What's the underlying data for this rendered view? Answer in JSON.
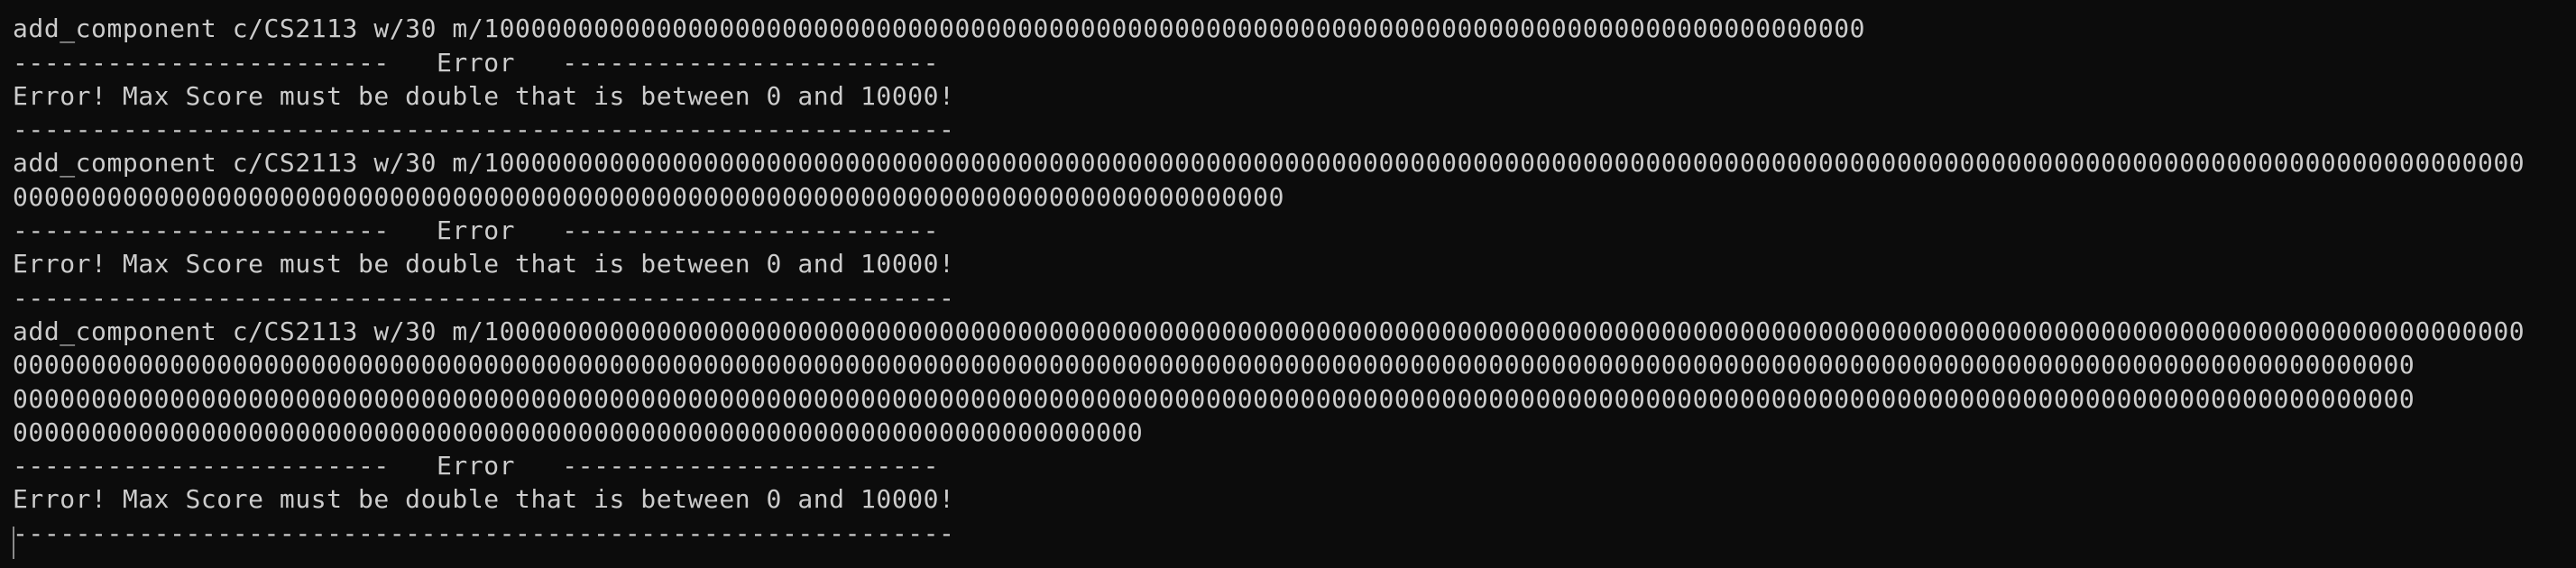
{
  "terminal": {
    "lines": [
      "------------------------------------------------------------",
      "add_component c/CS2113 w/30 m/1000000000000000000000000000000000000000000000000000000000000000000000000000000000000000",
      "------------------------   Error   ------------------------",
      "Error! Max Score must be double that is between 0 and 10000!",
      "------------------------------------------------------------",
      "add_component c/CS2113 w/30 m/1000000000000000000000000000000000000000000000000000000000000000000000000000000000000000000000000000000000000000000000000000000000",
      "000000000000000000000000000000000000000000000000000000000000000000000000000000000",
      "------------------------   Error   ------------------------",
      "Error! Max Score must be double that is between 0 and 10000!",
      "------------------------------------------------------------",
      "add_component c/CS2113 w/30 m/1000000000000000000000000000000000000000000000000000000000000000000000000000000000000000000000000000000000000000000000000000000000",
      "000000000000000000000000000000000000000000000000000000000000000000000000000000000000000000000000000000000000000000000000000000000000000000000000000000000",
      "000000000000000000000000000000000000000000000000000000000000000000000000000000000000000000000000000000000000000000000000000000000000000000000000000000000",
      "000000000000000000000000000000000000000000000000000000000000000000000000",
      "------------------------   Error   ------------------------",
      "Error! Max Score must be double that is between 0 and 10000!",
      "------------------------------------------------------------"
    ]
  }
}
